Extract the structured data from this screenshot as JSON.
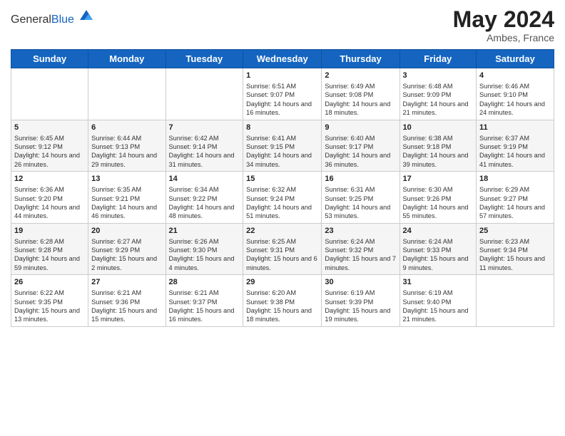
{
  "header": {
    "logo_general": "General",
    "logo_blue": "Blue",
    "month_year": "May 2024",
    "location": "Ambes, France"
  },
  "days_of_week": [
    "Sunday",
    "Monday",
    "Tuesday",
    "Wednesday",
    "Thursday",
    "Friday",
    "Saturday"
  ],
  "weeks": [
    [
      {
        "day": "",
        "content": ""
      },
      {
        "day": "",
        "content": ""
      },
      {
        "day": "",
        "content": ""
      },
      {
        "day": "1",
        "content": "Sunrise: 6:51 AM\nSunset: 9:07 PM\nDaylight: 14 hours and 16 minutes."
      },
      {
        "day": "2",
        "content": "Sunrise: 6:49 AM\nSunset: 9:08 PM\nDaylight: 14 hours and 18 minutes."
      },
      {
        "day": "3",
        "content": "Sunrise: 6:48 AM\nSunset: 9:09 PM\nDaylight: 14 hours and 21 minutes."
      },
      {
        "day": "4",
        "content": "Sunrise: 6:46 AM\nSunset: 9:10 PM\nDaylight: 14 hours and 24 minutes."
      }
    ],
    [
      {
        "day": "5",
        "content": "Sunrise: 6:45 AM\nSunset: 9:12 PM\nDaylight: 14 hours and 26 minutes."
      },
      {
        "day": "6",
        "content": "Sunrise: 6:44 AM\nSunset: 9:13 PM\nDaylight: 14 hours and 29 minutes."
      },
      {
        "day": "7",
        "content": "Sunrise: 6:42 AM\nSunset: 9:14 PM\nDaylight: 14 hours and 31 minutes."
      },
      {
        "day": "8",
        "content": "Sunrise: 6:41 AM\nSunset: 9:15 PM\nDaylight: 14 hours and 34 minutes."
      },
      {
        "day": "9",
        "content": "Sunrise: 6:40 AM\nSunset: 9:17 PM\nDaylight: 14 hours and 36 minutes."
      },
      {
        "day": "10",
        "content": "Sunrise: 6:38 AM\nSunset: 9:18 PM\nDaylight: 14 hours and 39 minutes."
      },
      {
        "day": "11",
        "content": "Sunrise: 6:37 AM\nSunset: 9:19 PM\nDaylight: 14 hours and 41 minutes."
      }
    ],
    [
      {
        "day": "12",
        "content": "Sunrise: 6:36 AM\nSunset: 9:20 PM\nDaylight: 14 hours and 44 minutes."
      },
      {
        "day": "13",
        "content": "Sunrise: 6:35 AM\nSunset: 9:21 PM\nDaylight: 14 hours and 46 minutes."
      },
      {
        "day": "14",
        "content": "Sunrise: 6:34 AM\nSunset: 9:22 PM\nDaylight: 14 hours and 48 minutes."
      },
      {
        "day": "15",
        "content": "Sunrise: 6:32 AM\nSunset: 9:24 PM\nDaylight: 14 hours and 51 minutes."
      },
      {
        "day": "16",
        "content": "Sunrise: 6:31 AM\nSunset: 9:25 PM\nDaylight: 14 hours and 53 minutes."
      },
      {
        "day": "17",
        "content": "Sunrise: 6:30 AM\nSunset: 9:26 PM\nDaylight: 14 hours and 55 minutes."
      },
      {
        "day": "18",
        "content": "Sunrise: 6:29 AM\nSunset: 9:27 PM\nDaylight: 14 hours and 57 minutes."
      }
    ],
    [
      {
        "day": "19",
        "content": "Sunrise: 6:28 AM\nSunset: 9:28 PM\nDaylight: 14 hours and 59 minutes."
      },
      {
        "day": "20",
        "content": "Sunrise: 6:27 AM\nSunset: 9:29 PM\nDaylight: 15 hours and 2 minutes."
      },
      {
        "day": "21",
        "content": "Sunrise: 6:26 AM\nSunset: 9:30 PM\nDaylight: 15 hours and 4 minutes."
      },
      {
        "day": "22",
        "content": "Sunrise: 6:25 AM\nSunset: 9:31 PM\nDaylight: 15 hours and 6 minutes."
      },
      {
        "day": "23",
        "content": "Sunrise: 6:24 AM\nSunset: 9:32 PM\nDaylight: 15 hours and 7 minutes."
      },
      {
        "day": "24",
        "content": "Sunrise: 6:24 AM\nSunset: 9:33 PM\nDaylight: 15 hours and 9 minutes."
      },
      {
        "day": "25",
        "content": "Sunrise: 6:23 AM\nSunset: 9:34 PM\nDaylight: 15 hours and 11 minutes."
      }
    ],
    [
      {
        "day": "26",
        "content": "Sunrise: 6:22 AM\nSunset: 9:35 PM\nDaylight: 15 hours and 13 minutes."
      },
      {
        "day": "27",
        "content": "Sunrise: 6:21 AM\nSunset: 9:36 PM\nDaylight: 15 hours and 15 minutes."
      },
      {
        "day": "28",
        "content": "Sunrise: 6:21 AM\nSunset: 9:37 PM\nDaylight: 15 hours and 16 minutes."
      },
      {
        "day": "29",
        "content": "Sunrise: 6:20 AM\nSunset: 9:38 PM\nDaylight: 15 hours and 18 minutes."
      },
      {
        "day": "30",
        "content": "Sunrise: 6:19 AM\nSunset: 9:39 PM\nDaylight: 15 hours and 19 minutes."
      },
      {
        "day": "31",
        "content": "Sunrise: 6:19 AM\nSunset: 9:40 PM\nDaylight: 15 hours and 21 minutes."
      },
      {
        "day": "",
        "content": ""
      }
    ]
  ]
}
